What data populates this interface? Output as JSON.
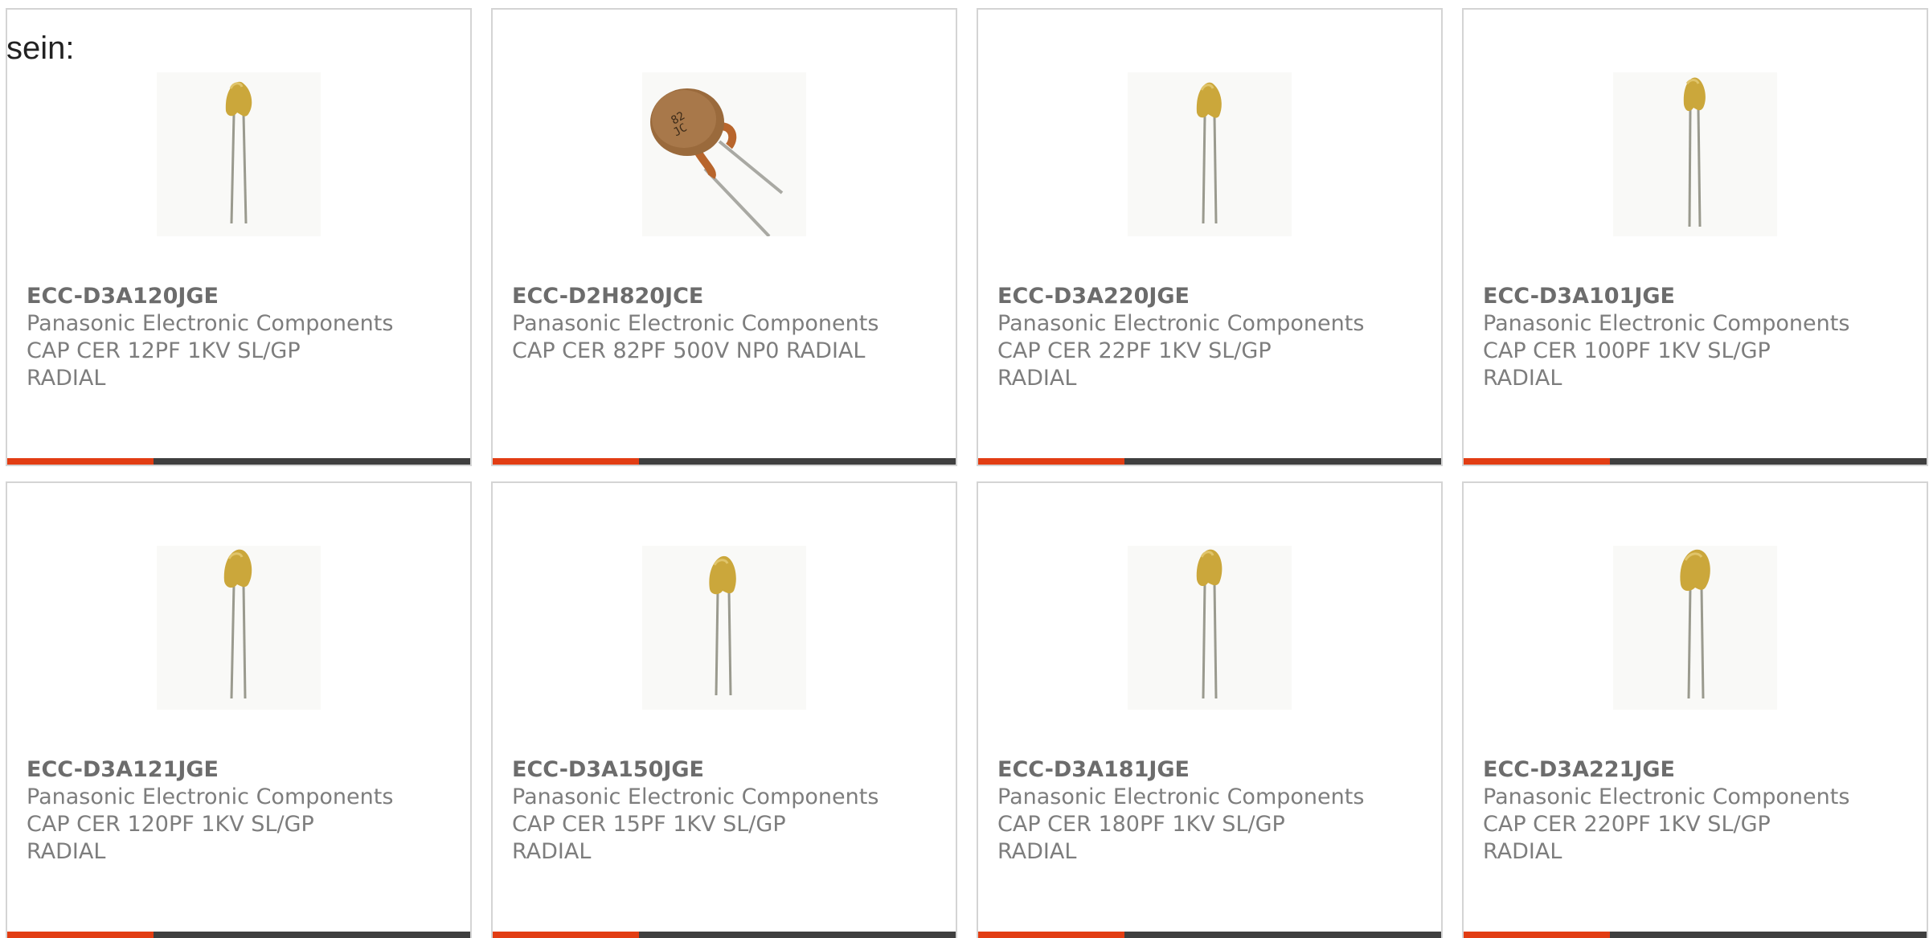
{
  "intro_text": "sein:",
  "accent_color": "#e23d13",
  "bar_color": "#3f3f3f",
  "products": [
    {
      "part_number": "ECC-D3A120JGE",
      "manufacturer": "Panasonic Electronic Components",
      "desc_line1": "CAP CER 12PF 1KV SL/GP",
      "desc_line2": "RADIAL",
      "image_icon": "ceramic-capacitor-small-icon"
    },
    {
      "part_number": "ECC-D2H820JCE",
      "manufacturer": "Panasonic Electronic Components",
      "desc_line1": "CAP CER 82PF 500V NP0 RADIAL",
      "desc_line2": "",
      "image_icon": "ceramic-disc-capacitor-icon"
    },
    {
      "part_number": "ECC-D3A220JGE",
      "manufacturer": "Panasonic Electronic Components",
      "desc_line1": "CAP CER 22PF 1KV SL/GP",
      "desc_line2": "RADIAL",
      "image_icon": "ceramic-capacitor-small-icon"
    },
    {
      "part_number": "ECC-D3A101JGE",
      "manufacturer": "Panasonic Electronic Components",
      "desc_line1": "CAP CER 100PF 1KV SL/GP",
      "desc_line2": "RADIAL",
      "image_icon": "ceramic-capacitor-small-icon"
    },
    {
      "part_number": "ECC-D3A121JGE",
      "manufacturer": "Panasonic Electronic Components",
      "desc_line1": "CAP CER 120PF 1KV SL/GP",
      "desc_line2": "RADIAL",
      "image_icon": "ceramic-capacitor-small-icon"
    },
    {
      "part_number": "ECC-D3A150JGE",
      "manufacturer": "Panasonic Electronic Components",
      "desc_line1": "CAP CER 15PF 1KV SL/GP",
      "desc_line2": "RADIAL",
      "image_icon": "ceramic-capacitor-small-icon"
    },
    {
      "part_number": "ECC-D3A181JGE",
      "manufacturer": "Panasonic Electronic Components",
      "desc_line1": "CAP CER 180PF 1KV SL/GP",
      "desc_line2": "RADIAL",
      "image_icon": "ceramic-capacitor-small-icon"
    },
    {
      "part_number": "ECC-D3A221JGE",
      "manufacturer": "Panasonic Electronic Components",
      "desc_line1": "CAP CER 220PF 1KV SL/GP",
      "desc_line2": "RADIAL",
      "image_icon": "ceramic-capacitor-small-icon"
    }
  ]
}
